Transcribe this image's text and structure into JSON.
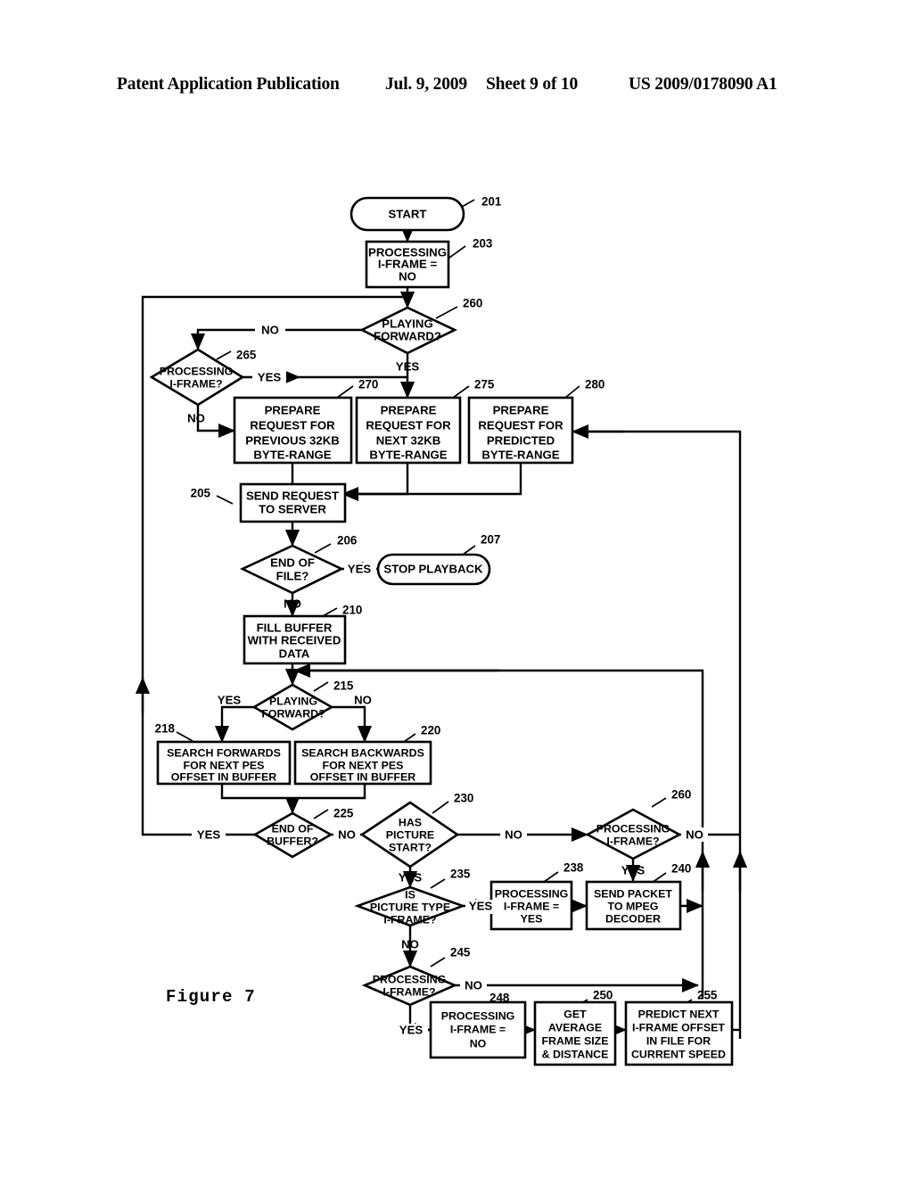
{
  "header": {
    "title": "Patent Application Publication",
    "date": "Jul. 9, 2009",
    "sheet": "Sheet 9 of 10",
    "number": "US 2009/0178090 A1"
  },
  "figure": {
    "caption": "Figure 7"
  },
  "chart_data": {
    "type": "diagram",
    "title": "Figure 7",
    "nodes": [
      {
        "ref": "201",
        "shape": "terminator",
        "text": "START"
      },
      {
        "ref": "203",
        "shape": "process",
        "text": "PROCESSING I-FRAME = NO"
      },
      {
        "ref": "260",
        "shape": "decision",
        "text": "PLAYING FORWARD?"
      },
      {
        "ref": "265",
        "shape": "decision",
        "text": "PROCESSING I-FRAME?"
      },
      {
        "ref": "270",
        "shape": "process",
        "text": "PREPARE REQUEST FOR PREVIOUS 32KB BYTE-RANGE"
      },
      {
        "ref": "275",
        "shape": "process",
        "text": "PREPARE REQUEST FOR NEXT 32KB BYTE-RANGE"
      },
      {
        "ref": "280",
        "shape": "process",
        "text": "PREPARE REQUEST FOR PREDICTED BYTE-RANGE"
      },
      {
        "ref": "205",
        "shape": "process",
        "text": "SEND REQUEST TO SERVER"
      },
      {
        "ref": "206",
        "shape": "decision",
        "text": "END OF FILE?"
      },
      {
        "ref": "207",
        "shape": "terminator",
        "text": "STOP PLAYBACK"
      },
      {
        "ref": "210",
        "shape": "process",
        "text": "FILL BUFFER WITH RECEIVED DATA"
      },
      {
        "ref": "215",
        "shape": "decision",
        "text": "PLAYING FORWARD?"
      },
      {
        "ref": "218",
        "shape": "process",
        "text": "SEARCH FORWARDS FOR NEXT PES OFFSET IN BUFFER"
      },
      {
        "ref": "220",
        "shape": "process",
        "text": "SEARCH BACKWARDS FOR NEXT PES OFFSET IN BUFFER"
      },
      {
        "ref": "225",
        "shape": "decision",
        "text": "END OF BUFFER?"
      },
      {
        "ref": "230",
        "shape": "decision",
        "text": "HAS PICTURE START?"
      },
      {
        "ref": "260b",
        "shape": "decision",
        "text": "PROCESSING I-FRAME?"
      },
      {
        "ref": "235",
        "shape": "decision",
        "text": "IS PICTURE TYPE I-FRAME?"
      },
      {
        "ref": "238",
        "shape": "process",
        "text": "PROCESSING I-FRAME = YES"
      },
      {
        "ref": "240",
        "shape": "process",
        "text": "SEND PACKET TO MPEG DECODER"
      },
      {
        "ref": "245",
        "shape": "decision",
        "text": "PROCESSING I-FRAME?"
      },
      {
        "ref": "248",
        "shape": "process",
        "text": "PROCESSING I-FRAME = NO"
      },
      {
        "ref": "250",
        "shape": "process",
        "text": "GET AVERAGE FRAME SIZE & DISTANCE"
      },
      {
        "ref": "255",
        "shape": "process",
        "text": "PREDICT NEXT I-FRAME OFFSET IN FILE FOR CURRENT SPEED"
      }
    ],
    "edges": [
      {
        "from": "201",
        "to": "203",
        "label": ""
      },
      {
        "from": "203",
        "to": "260",
        "label": ""
      },
      {
        "from": "260",
        "to": "265",
        "label": "NO"
      },
      {
        "from": "260",
        "to": "275",
        "label": "YES"
      },
      {
        "from": "265",
        "to": "280",
        "label": "YES"
      },
      {
        "from": "265",
        "to": "270",
        "label": "NO"
      },
      {
        "from": "270",
        "to": "205",
        "label": ""
      },
      {
        "from": "275",
        "to": "205",
        "label": ""
      },
      {
        "from": "280",
        "to": "205",
        "label": ""
      },
      {
        "from": "205",
        "to": "206",
        "label": ""
      },
      {
        "from": "206",
        "to": "207",
        "label": "YES"
      },
      {
        "from": "206",
        "to": "210",
        "label": "NO"
      },
      {
        "from": "210",
        "to": "215",
        "label": ""
      },
      {
        "from": "215",
        "to": "218",
        "label": "YES"
      },
      {
        "from": "215",
        "to": "220",
        "label": "NO"
      },
      {
        "from": "218",
        "to": "225",
        "label": ""
      },
      {
        "from": "220",
        "to": "225",
        "label": ""
      },
      {
        "from": "225",
        "to": "260",
        "label": "YES"
      },
      {
        "from": "225",
        "to": "230",
        "label": "NO"
      },
      {
        "from": "230",
        "to": "235",
        "label": "YES"
      },
      {
        "from": "230",
        "to": "260b",
        "label": "NO"
      },
      {
        "from": "260b",
        "to": "240",
        "label": "YES"
      },
      {
        "from": "260b",
        "to": "215",
        "label": "NO"
      },
      {
        "from": "235",
        "to": "238",
        "label": "YES"
      },
      {
        "from": "235",
        "to": "245",
        "label": "NO"
      },
      {
        "from": "238",
        "to": "240",
        "label": ""
      },
      {
        "from": "240",
        "to": "215",
        "label": ""
      },
      {
        "from": "245",
        "to": "248",
        "label": "YES"
      },
      {
        "from": "245",
        "to": "215",
        "label": "NO"
      },
      {
        "from": "248",
        "to": "250",
        "label": ""
      },
      {
        "from": "250",
        "to": "255",
        "label": ""
      },
      {
        "from": "255",
        "to": "280",
        "label": ""
      }
    ]
  },
  "nodes": {
    "n201": {
      "text": "START",
      "ref": "201"
    },
    "n203": {
      "l1": "PROCESSING",
      "l2": "I-FRAME =",
      "l3": "NO",
      "ref": "203"
    },
    "n260": {
      "l1": "PLAYING",
      "l2": "FORWARD?",
      "ref": "260"
    },
    "n265": {
      "l1": "PROCESSING",
      "l2": "I-FRAME?",
      "ref": "265"
    },
    "n270": {
      "l1": "PREPARE",
      "l2": "REQUEST FOR",
      "l3": "PREVIOUS 32KB",
      "l4": "BYTE-RANGE",
      "ref": "270"
    },
    "n275": {
      "l1": "PREPARE",
      "l2": "REQUEST FOR",
      "l3": "NEXT 32KB",
      "l4": "BYTE-RANGE",
      "ref": "275"
    },
    "n280": {
      "l1": "PREPARE",
      "l2": "REQUEST FOR",
      "l3": "PREDICTED",
      "l4": "BYTE-RANGE",
      "ref": "280"
    },
    "n205": {
      "l1": "SEND REQUEST",
      "l2": "TO SERVER",
      "ref": "205"
    },
    "n206": {
      "l1": "END OF",
      "l2": "FILE?",
      "ref": "206"
    },
    "n207": {
      "text": "STOP PLAYBACK",
      "ref": "207"
    },
    "n210": {
      "l1": "FILL BUFFER",
      "l2": "WITH RECEIVED",
      "l3": "DATA",
      "ref": "210"
    },
    "n215": {
      "l1": "PLAYING",
      "l2": "FORWARD?",
      "ref": "215"
    },
    "n218": {
      "l1": "SEARCH FORWARDS",
      "l2": "FOR NEXT PES",
      "l3": "OFFSET IN BUFFER",
      "ref": "218"
    },
    "n220": {
      "l1": "SEARCH BACKWARDS",
      "l2": "FOR NEXT PES",
      "l3": "OFFSET IN BUFFER",
      "ref": "220"
    },
    "n225": {
      "l1": "END OF",
      "l2": "BUFFER?",
      "ref": "225"
    },
    "n230": {
      "l1": "HAS",
      "l2": "PICTURE",
      "l3": "START?",
      "ref": "230"
    },
    "n260b": {
      "l1": "PROCESSING",
      "l2": "I-FRAME?",
      "ref": "260"
    },
    "n235": {
      "l1": "IS",
      "l2": "PICTURE TYPE",
      "l3": "I-FRAME?",
      "ref": "235"
    },
    "n238": {
      "l1": "PROCESSING",
      "l2": "I-FRAME =",
      "l3": "YES",
      "ref": "238"
    },
    "n240": {
      "l1": "SEND PACKET",
      "l2": "TO MPEG",
      "l3": "DECODER",
      "ref": "240"
    },
    "n245": {
      "l1": "PROCESSING",
      "l2": "I-FRAME?",
      "ref": "245"
    },
    "n248": {
      "l1": "PROCESSING",
      "l2": "I-FRAME =",
      "l3": "NO",
      "ref": "248"
    },
    "n250": {
      "l1": "GET",
      "l2": "AVERAGE",
      "l3": "FRAME SIZE",
      "l4": "& DISTANCE",
      "ref": "250"
    },
    "n255": {
      "l1": "PREDICT NEXT",
      "l2": "I-FRAME OFFSET",
      "l3": "IN FILE FOR",
      "l4": "CURRENT SPEED",
      "ref": "255"
    }
  },
  "labels": {
    "yes": "YES",
    "no": "NO",
    "e260_no": "NO",
    "e260_yes": "YES",
    "e265_yes": "YES",
    "e265_no": "NO",
    "e206_yes": "YES",
    "e215_yes": "YES",
    "e215_no": "NO",
    "e225_yes": "YES",
    "e225_no": "NO",
    "e230_no": "NO",
    "e230_yes": "YES",
    "e260b_no": "NO",
    "e260b_yes": "YES",
    "e235_yes": "YES",
    "e245_no": "NO",
    "e245_yes": "YES",
    "e206_no": "NO",
    "e235_no": "NO"
  }
}
